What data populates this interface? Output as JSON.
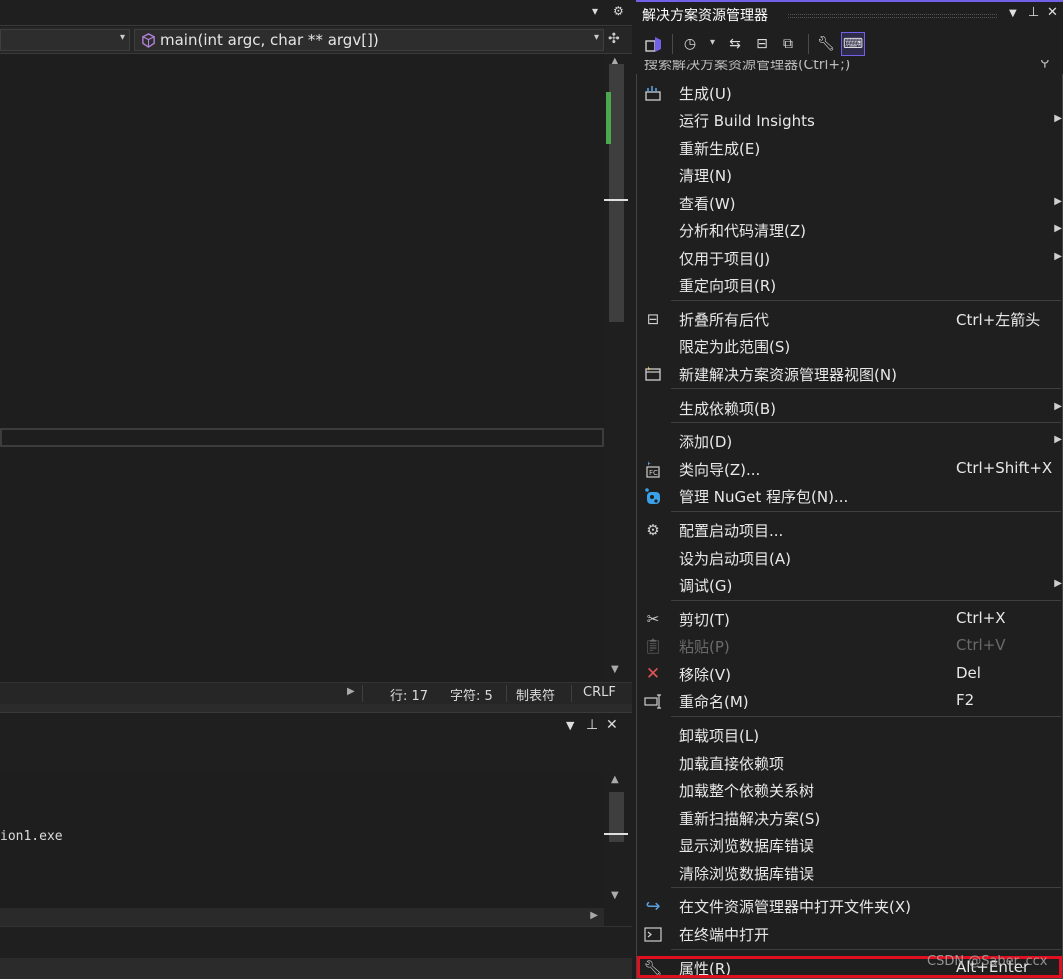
{
  "editor": {
    "function_selector": "main(int argc, char ** argv[])",
    "status": {
      "line": "行: 17",
      "char": "字符: 5",
      "tabs": "制表符",
      "eol": "CRLF"
    },
    "output_text": "ion1.exe"
  },
  "solution_explorer": {
    "title": "解决方案资源管理器",
    "search_placeholder": "搜索解决方案资源管理器(Ctrl+;)"
  },
  "context_menu": {
    "items": [
      {
        "label": "生成(U)",
        "shortcut": "",
        "icon": "build-icon"
      },
      {
        "label": "运行 Build Insights",
        "shortcut": "",
        "submenu": true
      },
      {
        "label": "重新生成(E)",
        "shortcut": ""
      },
      {
        "label": "清理(N)",
        "shortcut": ""
      },
      {
        "label": "查看(W)",
        "shortcut": "",
        "submenu": true
      },
      {
        "label": "分析和代码清理(Z)",
        "shortcut": "",
        "submenu": true
      },
      {
        "label": "仅用于项目(J)",
        "shortcut": "",
        "submenu": true
      },
      {
        "label": "重定向项目(R)",
        "shortcut": ""
      },
      {
        "label": "折叠所有后代",
        "shortcut": "Ctrl+左箭头",
        "icon": "collapse-icon"
      },
      {
        "label": "限定为此范围(S)",
        "shortcut": ""
      },
      {
        "label": "新建解决方案资源管理器视图(N)",
        "shortcut": "",
        "icon": "new-view-icon"
      },
      {
        "label": "生成依赖项(B)",
        "shortcut": "",
        "submenu": true
      },
      {
        "label": "添加(D)",
        "shortcut": "",
        "submenu": true
      },
      {
        "label": "类向导(Z)...",
        "shortcut": "Ctrl+Shift+X",
        "icon": "class-wizard-icon"
      },
      {
        "label": "管理 NuGet 程序包(N)...",
        "shortcut": "",
        "icon": "nuget-icon"
      },
      {
        "label": "配置启动项目...",
        "shortcut": "",
        "icon": "gear-icon"
      },
      {
        "label": "设为启动项目(A)",
        "shortcut": ""
      },
      {
        "label": "调试(G)",
        "shortcut": "",
        "submenu": true
      },
      {
        "label": "剪切(T)",
        "shortcut": "Ctrl+X",
        "icon": "cut-icon"
      },
      {
        "label": "粘贴(P)",
        "shortcut": "Ctrl+V",
        "icon": "paste-icon",
        "disabled": true
      },
      {
        "label": "移除(V)",
        "shortcut": "Del",
        "icon": "remove-icon"
      },
      {
        "label": "重命名(M)",
        "shortcut": "F2",
        "icon": "rename-icon"
      },
      {
        "label": "卸载项目(L)",
        "shortcut": ""
      },
      {
        "label": "加载直接依赖项",
        "shortcut": ""
      },
      {
        "label": "加载整个依赖关系树",
        "shortcut": ""
      },
      {
        "label": "重新扫描解决方案(S)",
        "shortcut": ""
      },
      {
        "label": "显示浏览数据库错误",
        "shortcut": ""
      },
      {
        "label": "清除浏览数据库错误",
        "shortcut": ""
      },
      {
        "label": "在文件资源管理器中打开文件夹(X)",
        "shortcut": "",
        "icon": "open-folder-icon"
      },
      {
        "label": "在终端中打开",
        "shortcut": "",
        "icon": "terminal-icon"
      },
      {
        "label": "属性(R)",
        "shortcut": "Alt+Enter",
        "icon": "wrench-icon"
      }
    ]
  },
  "watermark": "CSDN @Saber_ccx",
  "colors": {
    "accent": "#7160e8",
    "highlight": "#e01020",
    "scroll_marker": "#4ca84c"
  }
}
